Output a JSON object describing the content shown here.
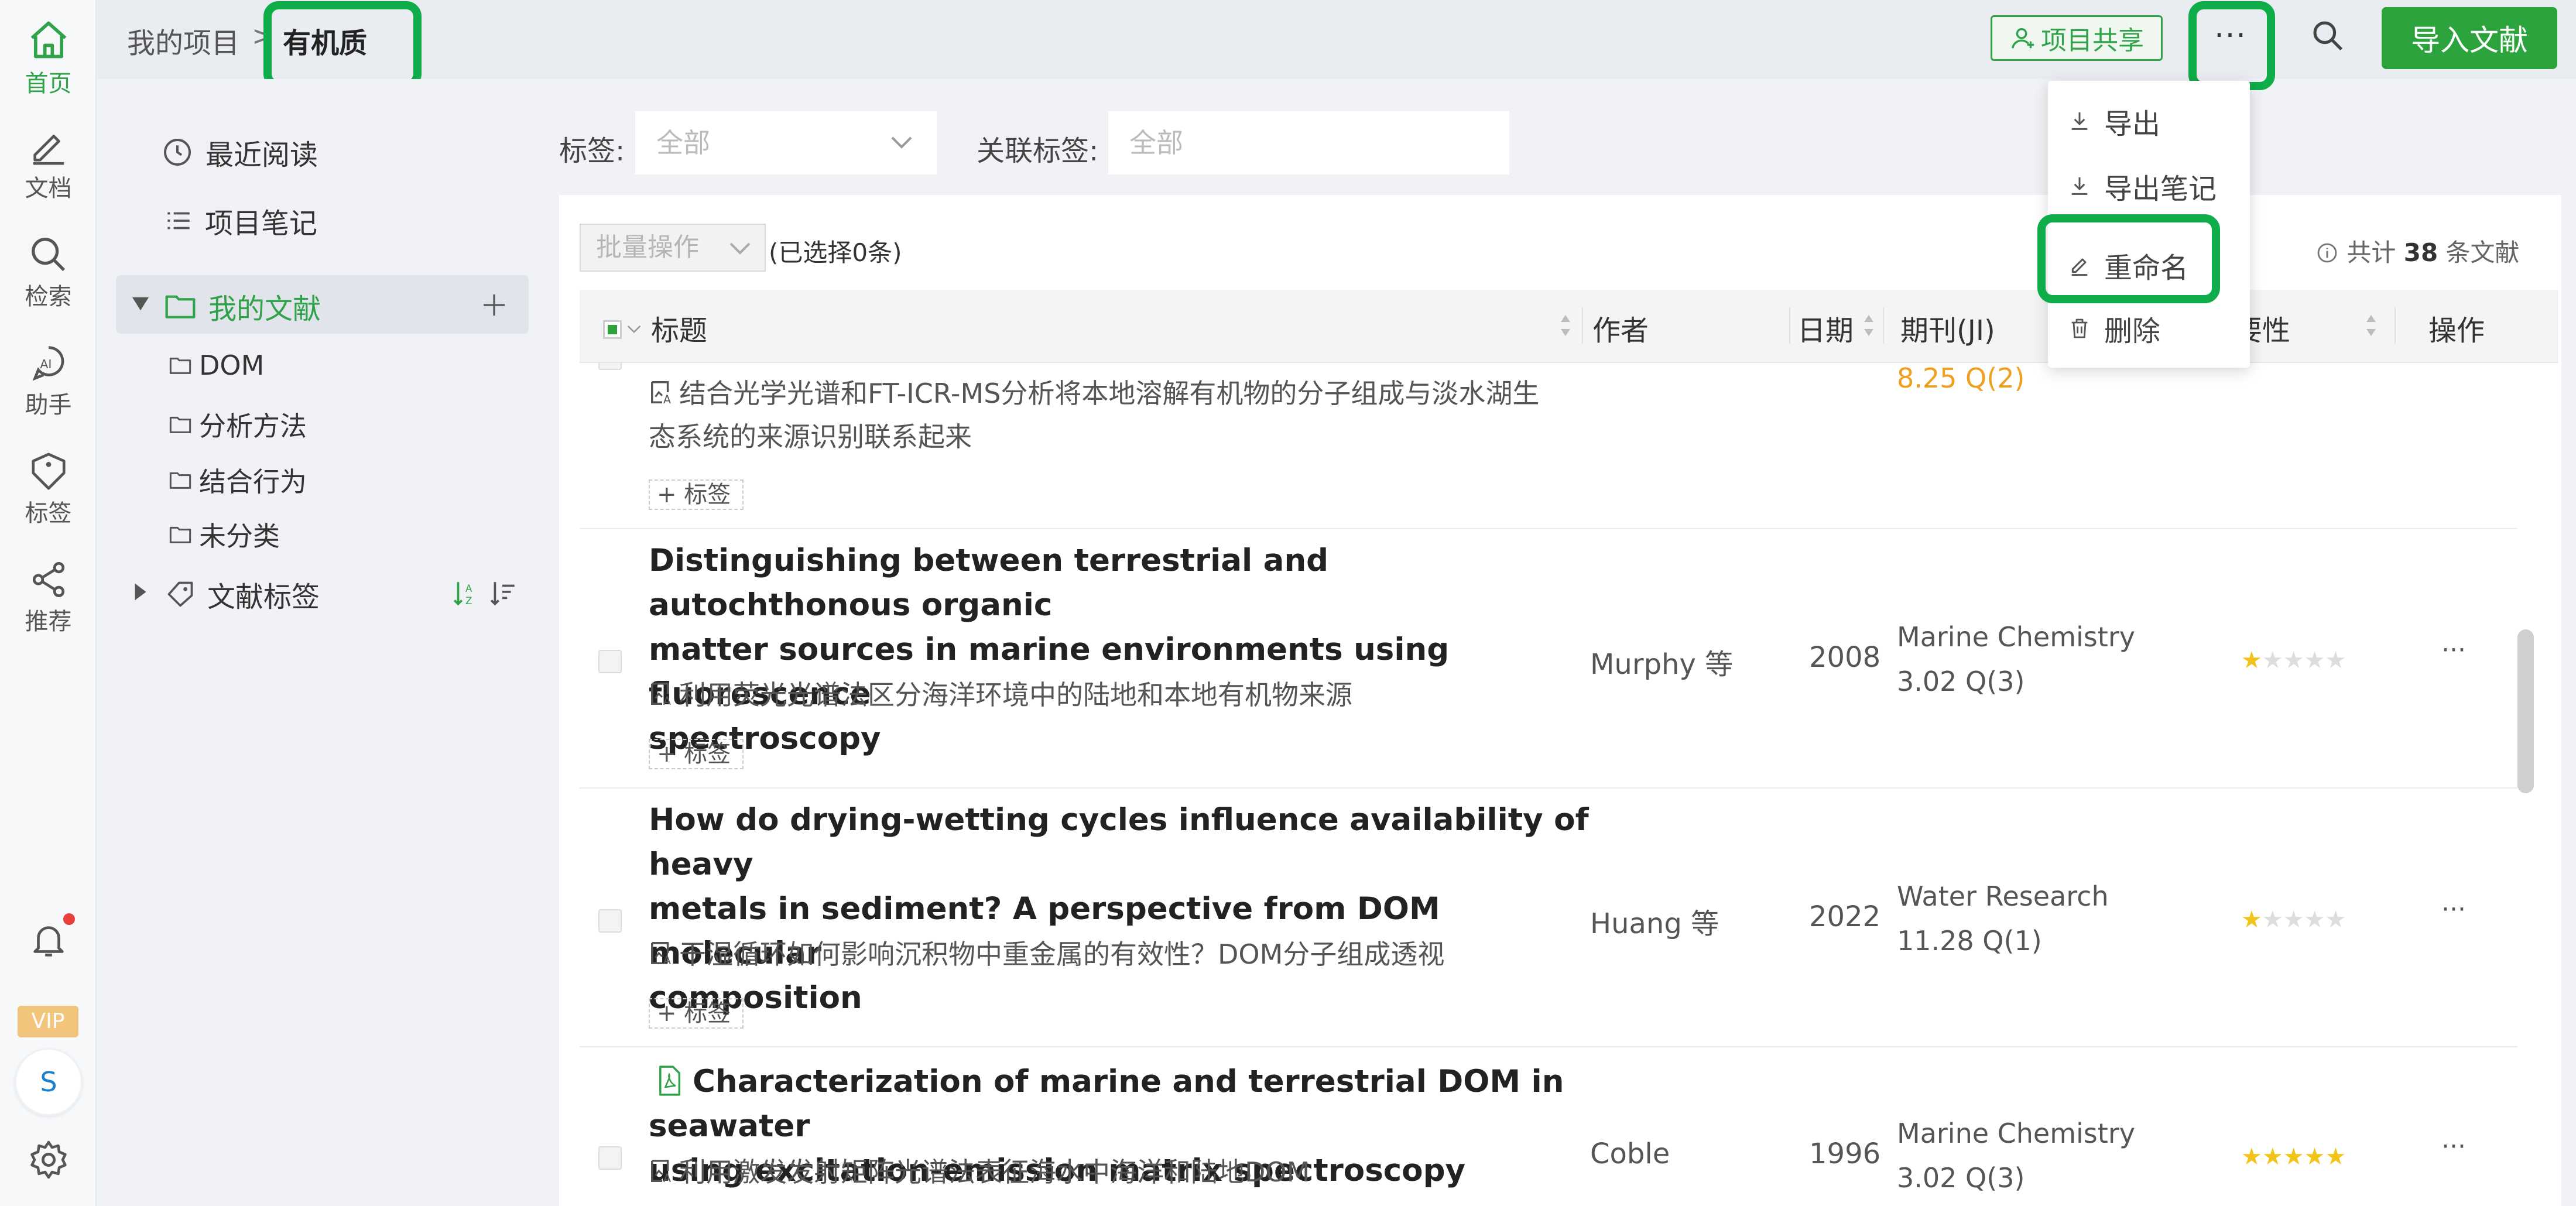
{
  "rail": {
    "home": "首页",
    "docs": "文档",
    "search": "检索",
    "assistant": "助手",
    "tags": "标签",
    "recommend": "推荐",
    "vip": "VIP",
    "avatar": "S"
  },
  "breadcrumb": {
    "root": "我的项目",
    "separator": ">",
    "current": "有机质"
  },
  "toolbar": {
    "share": "项目共享",
    "more": "···",
    "import": "导入文献"
  },
  "dropdown": {
    "items": [
      {
        "label": "导出",
        "icon": "download-icon"
      },
      {
        "label": "导出笔记",
        "icon": "download-icon"
      },
      {
        "label": "重命名",
        "icon": "edit-icon"
      },
      {
        "label": "删除",
        "icon": "trash-icon"
      }
    ]
  },
  "sidebar": {
    "recent": "最近阅读",
    "notes": "项目笔记",
    "mydocs": "我的文献",
    "folders": [
      "DOM",
      "分析方法",
      "结合行为",
      "未分类"
    ],
    "doc_tags": "文献标签"
  },
  "filters": {
    "tag_label": "标签:",
    "tag_value": "全部",
    "related_label": "关联标签:",
    "related_placeholder": "全部"
  },
  "list": {
    "batch": "批量操作",
    "selected": "(已选择0条)",
    "total_prefix": "共计",
    "total_count": "38",
    "total_suffix": "条文献",
    "columns": {
      "title": "标题",
      "author": "作者",
      "date": "日期",
      "journal": "期刊(JI)",
      "importance": "要性",
      "action": "操作"
    },
    "tag_button": "+ 标签",
    "partial_row": {
      "zh_line1": "结合光学光谱和FT-ICR-MS分析将本地溶解有机物的分子组成与淡水湖生",
      "zh_line2": "态系统的来源识别联系起来",
      "journal_metric": "8.25 Q(2)"
    },
    "rows": [
      {
        "title_lines": [
          "Distinguishing between terrestrial and autochthonous organic",
          "matter sources in marine environments using fluorescence",
          "spectroscopy"
        ],
        "zh": "利用荧光光谱法区分海洋环境中的陆地和本地有机物来源",
        "author": "Murphy 等",
        "year": "2008",
        "journal": "Marine Chemistry",
        "metric": "3.02 Q(3)",
        "rating": 1,
        "more": "···"
      },
      {
        "title_lines": [
          "How do drying-wetting cycles influence availability of heavy",
          "metals in sediment? A perspective from DOM molecular",
          "composition"
        ],
        "zh": "干湿循环如何影响沉积物中重金属的有效性？DOM分子组成透视",
        "author": "Huang 等",
        "year": "2022",
        "journal": "Water Research",
        "metric": "11.28 Q(1)",
        "rating": 1,
        "more": "···"
      },
      {
        "title_lines": [
          "Characterization of marine and terrestrial DOM in seawater",
          "using excitation-emission matrix spectroscopy"
        ],
        "zh": "利用激发发射矩阵光谱法表征海水中海洋和陆地DOM",
        "author": "Coble",
        "year": "1996",
        "journal": "Marine Chemistry",
        "metric": "3.02 Q(3)",
        "rating": 5,
        "more": "···"
      }
    ]
  },
  "colors": {
    "accent": "#2fa24a",
    "highlight": "#0fac4a",
    "star": "#f0c419",
    "orange_metric": "#f0a020"
  }
}
